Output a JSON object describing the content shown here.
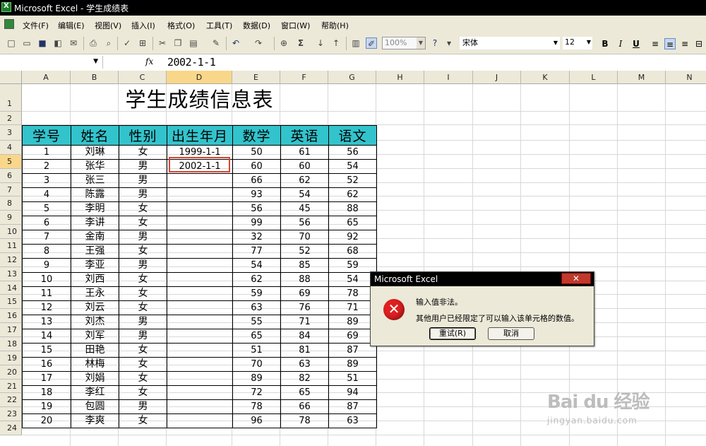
{
  "window": {
    "title": "Microsoft Excel - 学生成绩表"
  },
  "menu": [
    "文件(F)",
    "编辑(E)",
    "视图(V)",
    "插入(I)",
    "格式(O)",
    "工具(T)",
    "数据(D)",
    "窗口(W)",
    "帮助(H)"
  ],
  "toolbar": {
    "zoom": "100%",
    "font": "宋体",
    "font_size": "12",
    "bold": "B",
    "italic": "I",
    "underline": "U"
  },
  "formula_bar": {
    "fx": "fx",
    "value": "2002-1-1"
  },
  "columns": [
    "A",
    "B",
    "C",
    "D",
    "E",
    "F",
    "G",
    "H",
    "I",
    "J",
    "K",
    "L",
    "M",
    "N"
  ],
  "rows": [
    "1",
    "2",
    "3",
    "4",
    "5",
    "6",
    "7",
    "8",
    "9",
    "10",
    "11",
    "12",
    "13",
    "14",
    "15",
    "16",
    "17",
    "18",
    "19",
    "20",
    "21",
    "22",
    "23",
    "24"
  ],
  "sheet": {
    "title": "学生成绩信息表",
    "headers": [
      "学号",
      "姓名",
      "性别",
      "出生年月",
      "数学",
      "英语",
      "语文"
    ],
    "records": [
      [
        "1",
        "刘琳",
        "女",
        "1999-1-1",
        "50",
        "61",
        "56"
      ],
      [
        "2",
        "张华",
        "男",
        "2002-1-1",
        "60",
        "60",
        "54"
      ],
      [
        "3",
        "张三",
        "男",
        "",
        "66",
        "62",
        "52"
      ],
      [
        "4",
        "陈露",
        "男",
        "",
        "93",
        "54",
        "62"
      ],
      [
        "5",
        "李明",
        "女",
        "",
        "56",
        "45",
        "88"
      ],
      [
        "6",
        "李讲",
        "女",
        "",
        "99",
        "56",
        "65"
      ],
      [
        "7",
        "金南",
        "男",
        "",
        "32",
        "70",
        "92"
      ],
      [
        "8",
        "王强",
        "女",
        "",
        "77",
        "52",
        "68"
      ],
      [
        "9",
        "李亚",
        "男",
        "",
        "54",
        "85",
        "59"
      ],
      [
        "10",
        "刘西",
        "女",
        "",
        "62",
        "88",
        "54"
      ],
      [
        "11",
        "王永",
        "女",
        "",
        "59",
        "69",
        "78"
      ],
      [
        "12",
        "刘云",
        "女",
        "",
        "63",
        "76",
        "71"
      ],
      [
        "13",
        "刘杰",
        "男",
        "",
        "55",
        "71",
        "89"
      ],
      [
        "14",
        "刘军",
        "男",
        "",
        "65",
        "84",
        "69"
      ],
      [
        "15",
        "田艳",
        "女",
        "",
        "51",
        "81",
        "87"
      ],
      [
        "16",
        "林梅",
        "女",
        "",
        "70",
        "63",
        "89"
      ],
      [
        "17",
        "刘娟",
        "女",
        "",
        "89",
        "82",
        "51"
      ],
      [
        "18",
        "李红",
        "女",
        "",
        "72",
        "65",
        "94"
      ],
      [
        "19",
        "包圆",
        "男",
        "",
        "78",
        "66",
        "87"
      ],
      [
        "20",
        "李爽",
        "女",
        "",
        "96",
        "78",
        "63"
      ]
    ]
  },
  "dialog": {
    "title": "Microsoft Excel",
    "close": "✕",
    "message1": "输入值非法。",
    "message2": "其他用户已经限定了可以输入该单元格的数值。",
    "retry": "重试(R)",
    "cancel": "取消"
  },
  "watermark": {
    "main": "Bai du 经验",
    "sub": "jingyan.baidu.com"
  },
  "colors": {
    "header_fill": "#33c3cc",
    "selection_border": "#dd3333",
    "titlebar": "#000000"
  }
}
